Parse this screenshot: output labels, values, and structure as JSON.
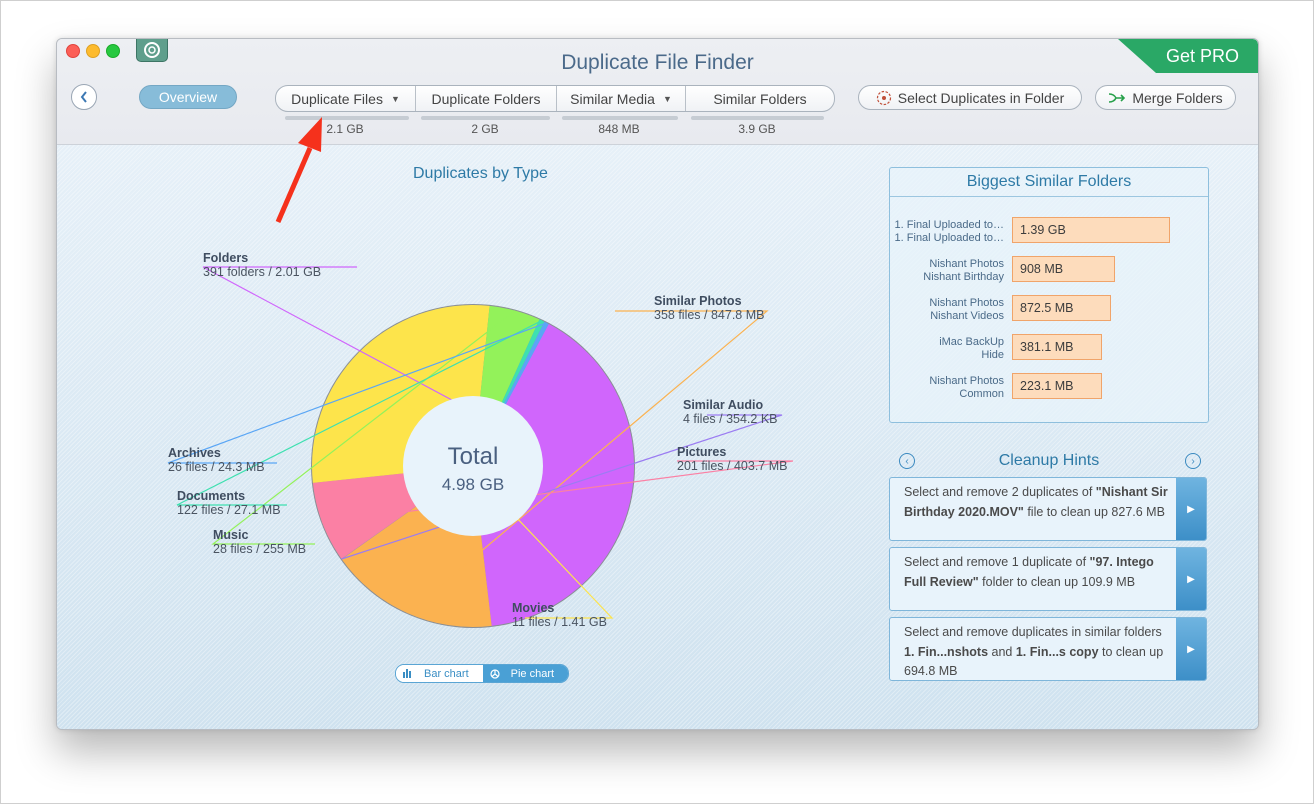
{
  "window": {
    "title": "Duplicate File Finder",
    "get_pro_label": "Get PRO"
  },
  "toolbar": {
    "back_icon": "chevron-left-icon",
    "overview_label": "Overview",
    "tabs": [
      {
        "label": "Duplicate Files",
        "has_dropdown": true,
        "size": "2.1 GB"
      },
      {
        "label": "Duplicate Folders",
        "has_dropdown": false,
        "size": "2 GB"
      },
      {
        "label": "Similar Media",
        "has_dropdown": true,
        "size": "848 MB"
      },
      {
        "label": "Similar Folders",
        "has_dropdown": false,
        "size": "3.9 GB"
      }
    ],
    "select_duplicates_label": "Select Duplicates in Folder",
    "merge_folders_label": "Merge Folders"
  },
  "chart_data": {
    "type": "pie",
    "title": "Duplicates by Type",
    "center_label": "Total",
    "center_value": "4.98 GB",
    "unit": "GB",
    "slices": [
      {
        "name": "Folders",
        "detail": "391 folders / 2.01 GB",
        "value": 2.01,
        "color": "#d066fc"
      },
      {
        "name": "Similar Photos",
        "detail": "358 files / 847.8 MB",
        "value": 0.8478,
        "color": "#fbb250"
      },
      {
        "name": "Similar Audio",
        "detail": "4 files / 354.2 KB",
        "value": 0.00035,
        "color": "#9b7cf2"
      },
      {
        "name": "Pictures",
        "detail": "201 files / 403.7 MB",
        "value": 0.4037,
        "color": "#fb80a4"
      },
      {
        "name": "Movies",
        "detail": "11 files / 1.41 GB",
        "value": 1.41,
        "color": "#fde44b"
      },
      {
        "name": "Music",
        "detail": "28 files / 255 MB",
        "value": 0.255,
        "color": "#93f25a"
      },
      {
        "name": "Documents",
        "detail": "122 files / 27.1 MB",
        "value": 0.0271,
        "color": "#3ee0b0"
      },
      {
        "name": "Archives",
        "detail": "26 files / 24.3 MB",
        "value": 0.0243,
        "color": "#5aa6f5"
      }
    ],
    "view_toggle": {
      "bar_label": "Bar chart",
      "pie_label": "Pie chart",
      "selected": "Pie chart"
    }
  },
  "biggest_similar_folders": {
    "title": "Biggest Similar Folders",
    "rows": [
      {
        "name1": "1. Final Uploaded to…",
        "name2": "1. Final Uploaded to…",
        "size": "1.39 GB",
        "value_mb": 1390
      },
      {
        "name1": "Nishant Photos",
        "name2": "Nishant Birthday",
        "size": "908 MB",
        "value_mb": 908
      },
      {
        "name1": "Nishant Photos",
        "name2": "Nishant Videos",
        "size": "872.5 MB",
        "value_mb": 872.5
      },
      {
        "name1": "iMac BackUp",
        "name2": "Hide",
        "size": "381.1 MB",
        "value_mb": 381.1
      },
      {
        "name1": "Nishant Photos",
        "name2": "Common",
        "size": "223.1 MB",
        "value_mb": 223.1
      }
    ]
  },
  "cleanup_hints": {
    "title": "Cleanup Hints",
    "items": [
      {
        "parts": [
          [
            "Select and remove 2 duplicates of ",
            false
          ],
          [
            "\"Nishant Sir Birthday 2020.MOV\"",
            true
          ],
          [
            " file to clean up 827.6 MB",
            false
          ]
        ]
      },
      {
        "parts": [
          [
            "Select and remove 1 duplicate of ",
            false
          ],
          [
            "\"97. Intego Full Review\"",
            true
          ],
          [
            " folder to clean up 109.9 MB",
            false
          ]
        ]
      },
      {
        "parts": [
          [
            "Select and remove duplicates in similar folders ",
            false
          ],
          [
            "1. Fin...nshots",
            true
          ],
          [
            " and ",
            false
          ],
          [
            "1. Fin...s copy",
            true
          ],
          [
            " to clean up 694.8 MB",
            false
          ]
        ]
      }
    ]
  },
  "annotation": {
    "arrow_color": "#f5311c",
    "points_to": "Duplicate Files size"
  }
}
